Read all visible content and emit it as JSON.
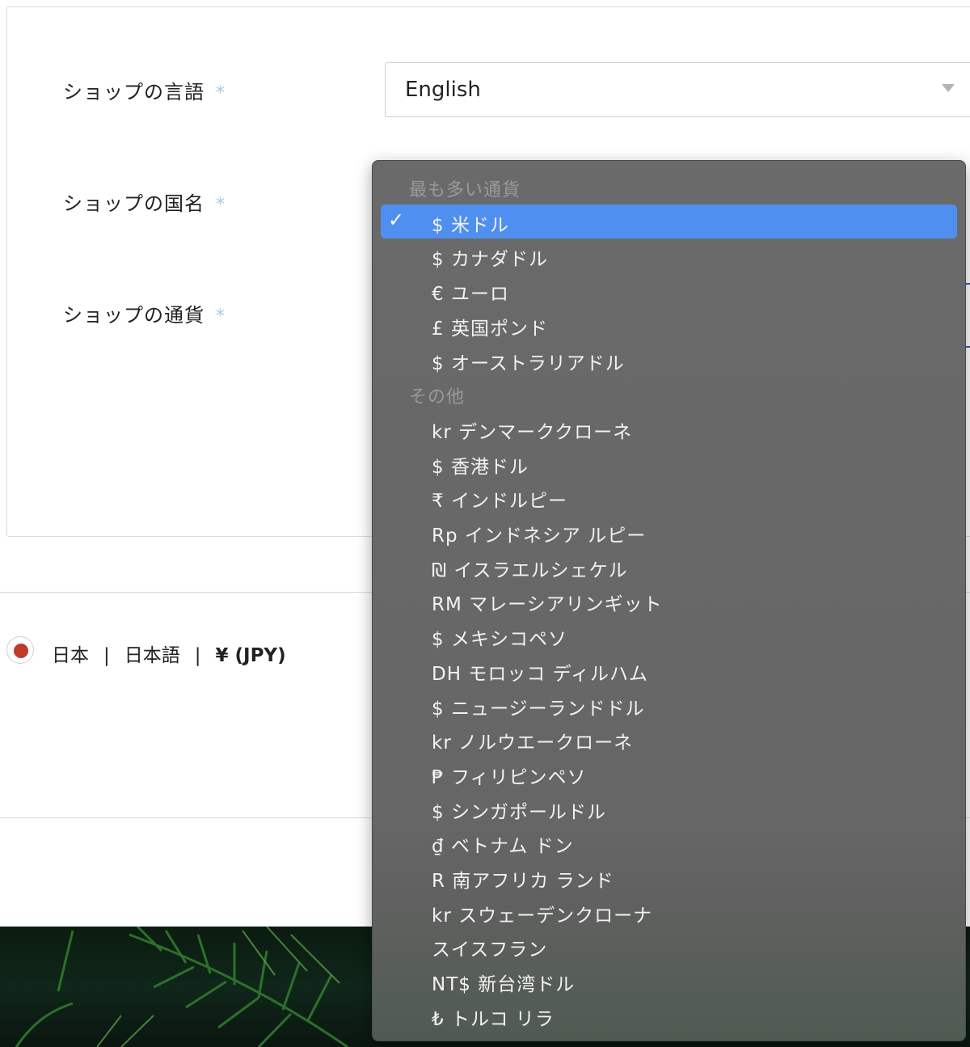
{
  "form": {
    "language_label": "ショップの言語",
    "country_label": "ショップの国名",
    "currency_label": "ショップの通貨",
    "required_mark": "*",
    "language_value": "English"
  },
  "locale_option": {
    "country": "日本",
    "language": "日本語",
    "currency": "¥ (JPY)",
    "separator": "|"
  },
  "currency_menu": {
    "groups": [
      {
        "header": "最も多い通貨",
        "items": [
          {
            "label": "$ 米ドル",
            "selected": true
          },
          {
            "label": "$ カナダドル"
          },
          {
            "label": "€ ユーロ"
          },
          {
            "label": "£ 英国ポンド"
          },
          {
            "label": "$ オーストラリアドル"
          }
        ]
      },
      {
        "header": "その他",
        "items": [
          {
            "label": "kr デンマーククローネ"
          },
          {
            "label": "$ 香港ドル"
          },
          {
            "label": "₹ インドルピー"
          },
          {
            "label": "Rp インドネシア ルピー"
          },
          {
            "label": "₪ イスラエルシェケル"
          },
          {
            "label": "RM マレーシアリンギット"
          },
          {
            "label": "$ メキシコペソ"
          },
          {
            "label": "DH モロッコ ディルハム"
          },
          {
            "label": "$ ニュージーランドドル"
          },
          {
            "label": "kr ノルウエークローネ"
          },
          {
            "label": "₱ フィリピンペソ"
          },
          {
            "label": "$ シンガポールドル"
          },
          {
            "label": "₫ ベトナム ドン"
          },
          {
            "label": "R 南アフリカ ランド"
          },
          {
            "label": "kr スウェーデンクローナ"
          },
          {
            "label": "スイスフラン"
          },
          {
            "label": "NT$ 新台湾ドル"
          },
          {
            "label": "₺ トルコ リラ"
          }
        ]
      }
    ],
    "check_glyph": "✓"
  },
  "colors": {
    "selected_bg": "#4f8ff0",
    "menu_bg": "#686868",
    "required_mark": "#9ccfe0",
    "radio_dot": "#c0392b"
  },
  "icons": {
    "select_caret": "chevron-down-icon",
    "check": "checkmark-icon"
  }
}
